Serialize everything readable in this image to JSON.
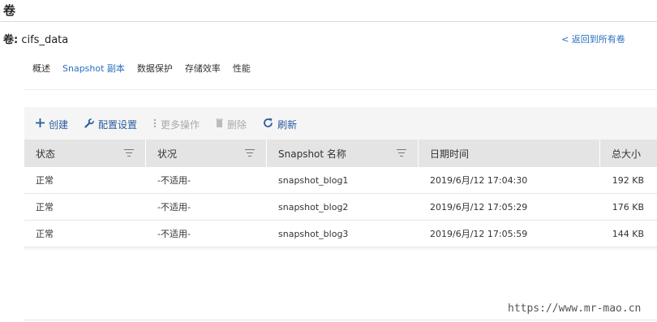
{
  "page_title": "卷",
  "volume": {
    "prefix": "卷:",
    "name": "cifs_data"
  },
  "back_link": "< 返回到所有卷",
  "subnav": {
    "tabs": [
      {
        "label": "概述"
      },
      {
        "label": "Snapshot 副本",
        "active": true
      },
      {
        "label": "数据保护"
      },
      {
        "label": "存储效率"
      },
      {
        "label": "性能"
      }
    ]
  },
  "toolbar": {
    "create": "创建",
    "configure": "配置设置",
    "more_actions": "更多操作",
    "delete": "删除",
    "refresh": "刷新"
  },
  "table": {
    "columns": [
      "状态",
      "状况",
      "Snapshot 名称",
      "日期时间",
      "总大小"
    ],
    "rows": [
      [
        "正常",
        "-不适用-",
        "snapshot_blog1",
        "2019/6月/12 17:04:30",
        "192 KB"
      ],
      [
        "正常",
        "-不适用-",
        "snapshot_blog2",
        "2019/6月/12 17:05:29",
        "176 KB"
      ],
      [
        "正常",
        "-不适用-",
        "snapshot_blog3",
        "2019/6月/12 17:05:59",
        "144 KB"
      ]
    ]
  },
  "watermark": "https://www.mr-mao.cn",
  "colors": {
    "link": "#2a6fc0",
    "toolbar_active": "#2a5c9e",
    "header_bg": "#e4e4e4",
    "disabled": "#aaaaaa"
  }
}
